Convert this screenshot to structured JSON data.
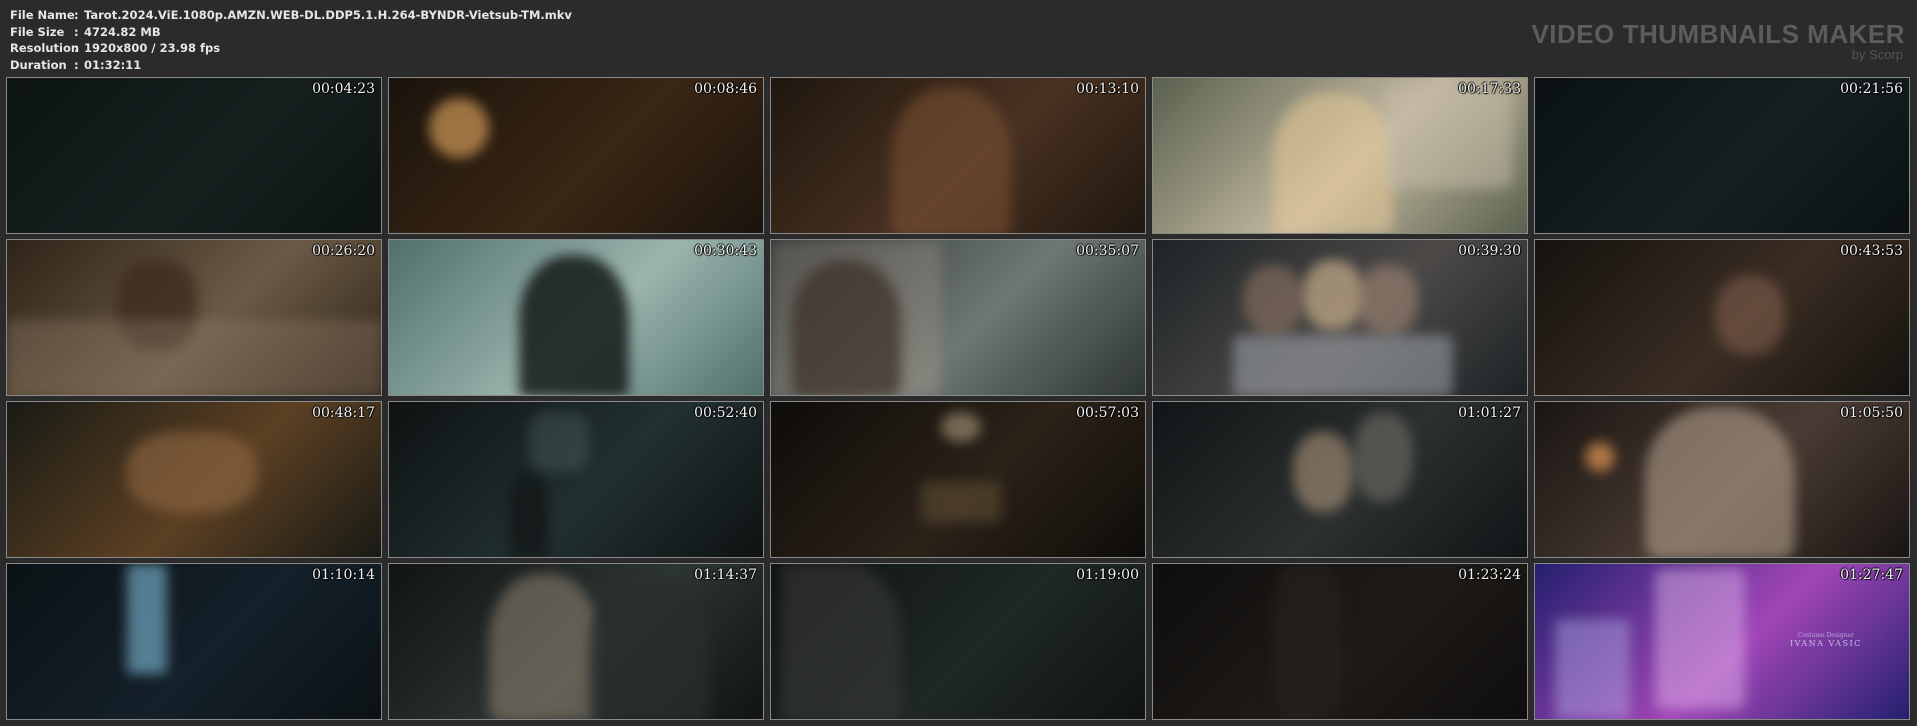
{
  "file_info": {
    "separator": ":",
    "fields": [
      {
        "key": "File Name",
        "value": "Tarot.2024.ViE.1080p.AMZN.WEB-DL.DDP5.1.H.264-BYNDR-Vietsub-TM.mkv"
      },
      {
        "key": "File Size",
        "value": "4724.82 MB"
      },
      {
        "key": "Resolution",
        "value": "1920x800 / 23.98 fps"
      },
      {
        "key": "Duration",
        "value": "01:32:11"
      }
    ]
  },
  "brand": {
    "title": "VIDEO THUMBNAILS MAKER",
    "subtitle": "by Scorp"
  },
  "thumbnails": [
    {
      "time": "00:04:23",
      "colors": [
        "#0d1413",
        "#15201f"
      ]
    },
    {
      "time": "00:08:46",
      "colors": [
        "#1a130c",
        "#3a2614"
      ]
    },
    {
      "time": "00:13:10",
      "colors": [
        "#1f170f",
        "#4a3222"
      ]
    },
    {
      "time": "00:17:33",
      "colors": [
        "#59614e",
        "#c2b79f"
      ]
    },
    {
      "time": "00:21:56",
      "colors": [
        "#0b1112",
        "#152022"
      ]
    },
    {
      "time": "00:26:20",
      "colors": [
        "#2e2318",
        "#6b5a45"
      ]
    },
    {
      "time": "00:30:43",
      "colors": [
        "#50706a",
        "#9bb4ae"
      ]
    },
    {
      "time": "00:35:07",
      "colors": [
        "#2e3535",
        "#6e7774"
      ]
    },
    {
      "time": "00:39:30",
      "colors": [
        "#1d2326",
        "#4d4a48"
      ]
    },
    {
      "time": "00:43:53",
      "colors": [
        "#15120e",
        "#3a2d23"
      ]
    },
    {
      "time": "00:48:17",
      "colors": [
        "#191a15",
        "#5c4023"
      ]
    },
    {
      "time": "00:52:40",
      "colors": [
        "#0e1212",
        "#223032"
      ]
    },
    {
      "time": "00:57:03",
      "colors": [
        "#0e0c09",
        "#2b2218"
      ]
    },
    {
      "time": "01:01:27",
      "colors": [
        "#111517",
        "#2c302f"
      ]
    },
    {
      "time": "01:05:50",
      "colors": [
        "#1a1512",
        "#4a3c34"
      ]
    },
    {
      "time": "01:10:14",
      "colors": [
        "#0b1215",
        "#14202a"
      ]
    },
    {
      "time": "01:14:37",
      "colors": [
        "#101414",
        "#2d3533"
      ]
    },
    {
      "time": "01:19:00",
      "colors": [
        "#0f1313",
        "#1f2827"
      ]
    },
    {
      "time": "01:23:24",
      "colors": [
        "#0f0e0d",
        "#1e1a17"
      ]
    },
    {
      "time": "01:27:47",
      "colors": [
        "#24206e",
        "#a146b7"
      ]
    }
  ],
  "end_credit": {
    "small": "Costume Designer",
    "big": "IVANA VASIC"
  }
}
